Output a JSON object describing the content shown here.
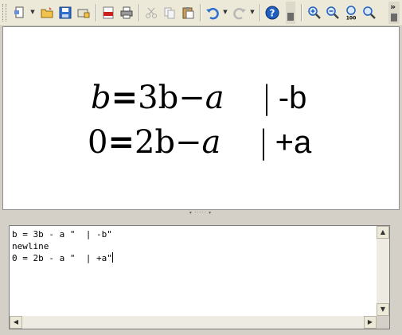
{
  "toolbar": {
    "buttons": [
      {
        "name": "new-icon"
      },
      {
        "name": "open-icon"
      },
      {
        "name": "save-icon"
      },
      {
        "name": "save-as-icon"
      },
      {
        "name": "export-pdf-icon"
      },
      {
        "name": "print-icon"
      },
      {
        "name": "cut-icon"
      },
      {
        "name": "copy-icon"
      },
      {
        "name": "paste-icon"
      },
      {
        "name": "undo-icon"
      },
      {
        "name": "redo-icon"
      },
      {
        "name": "help-icon"
      },
      {
        "name": "zoom-in-icon"
      },
      {
        "name": "zoom-out-icon"
      },
      {
        "name": "zoom-100-icon",
        "label": "100"
      },
      {
        "name": "zoom-fit-icon"
      }
    ],
    "overflow_label": "»",
    "colors": {
      "accent_blue": "#2f6fcf",
      "pdf_red": "#c8231f",
      "help_blue": "#1f5fbf"
    }
  },
  "preview": {
    "line1": {
      "lhs": "b",
      "eq": "=",
      "rhs_a": "3b",
      "minus": "−",
      "rhs_b": "a",
      "bar": "|",
      "op": "-b"
    },
    "line2": {
      "lhs": "0",
      "eq": "=",
      "rhs_a": "2b",
      "minus": "−",
      "rhs_b": "a",
      "bar": "|",
      "op": "+a"
    }
  },
  "splitter": {
    "grip": "▾ ····· ▾"
  },
  "editor": {
    "lines": [
      "b = 3b - a \"  | -b\"",
      "newline",
      "0 = 2b - a \"  | +a\""
    ]
  }
}
